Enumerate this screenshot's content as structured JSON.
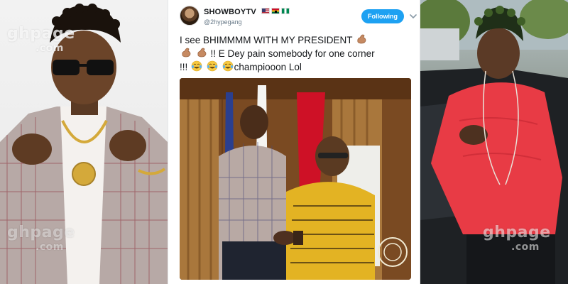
{
  "tweet": {
    "display_name": "SHOWBOYTV",
    "flags": [
      "us-flag",
      "ghana-flag",
      "nigeria-flag"
    ],
    "handle": "@2hypegang",
    "follow_label": "Following",
    "text_line1": "I see BHIMMMM WITH  MY PRESIDENT",
    "text_line2_suffix": "!! E Dey pain somebody for one corner",
    "text_line3_prefix": "!!!",
    "text_line3_suffix": "champiooon Lol",
    "emojis": [
      "flexed-biceps",
      "flexed-biceps",
      "flexed-biceps",
      "face-with-tears-of-joy",
      "face-with-tears-of-joy",
      "face-with-tears-of-joy"
    ]
  },
  "watermarks": {
    "left_top_main": "ghpage",
    "left_top_sub": ".com",
    "left_bottom_main": "ghpage",
    "left_bottom_sub": ".com",
    "right_bottom_main": "ghpage",
    "right_bottom_sub": ".com"
  },
  "colors": {
    "follow_button": "#1da1f2",
    "ghana_red": "#ce1126",
    "ghana_gold": "#fcd116",
    "ghana_green": "#006b3f"
  }
}
